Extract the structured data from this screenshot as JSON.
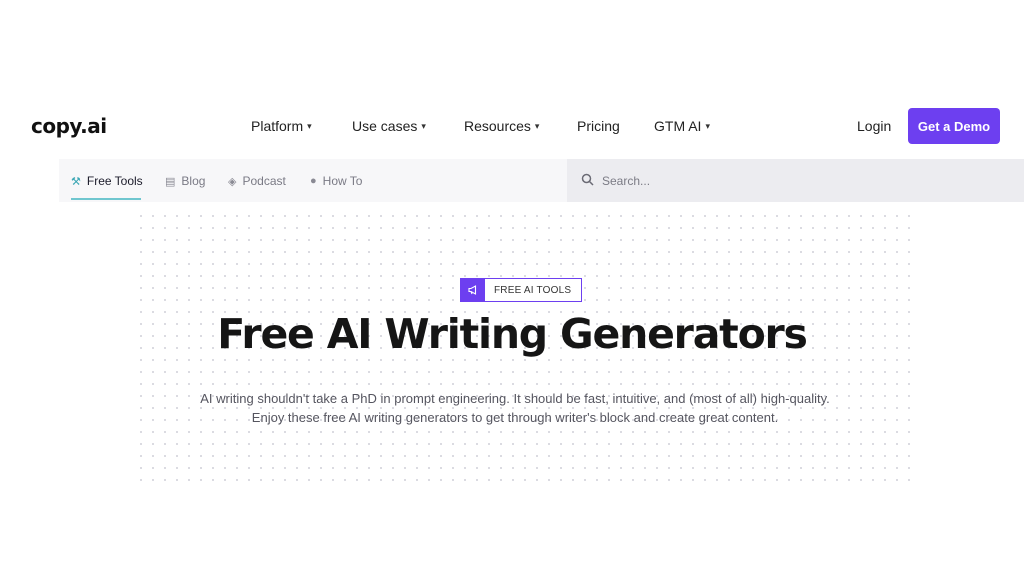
{
  "header": {
    "logo": "copy.ai",
    "nav": [
      {
        "label": "Platform",
        "has_dropdown": true
      },
      {
        "label": "Use cases",
        "has_dropdown": true
      },
      {
        "label": "Resources",
        "has_dropdown": true
      },
      {
        "label": "Pricing",
        "has_dropdown": false
      },
      {
        "label": "GTM AI",
        "has_dropdown": true
      }
    ],
    "login_label": "Login",
    "cta_label": "Get a Demo",
    "chevron": "⌄"
  },
  "subnav": {
    "items": [
      {
        "label": "Free Tools",
        "icon": "tools-icon",
        "active": true
      },
      {
        "label": "Blog",
        "icon": "newspaper-icon",
        "active": false
      },
      {
        "label": "Podcast",
        "icon": "graduation-cap-icon",
        "active": false
      },
      {
        "label": "How To",
        "icon": "info-circle-icon",
        "active": false
      }
    ],
    "search": {
      "placeholder": "Search...",
      "value": ""
    }
  },
  "hero": {
    "badge_icon": "megaphone-icon",
    "badge_text": "FREE AI TOOLS",
    "title": "Free AI Writing Generators",
    "description_line1": "AI writing shouldn't take a PhD in prompt engineering. It should be fast, intuitive, and (most of all) high-quality.",
    "description_line2": "Enjoy these free AI writing generators to get through writer's block and create great content."
  },
  "colors": {
    "accent": "#6d3ff0",
    "subnav_active_underline": "#6fc6cf",
    "subnav_bg": "#f7f7f9",
    "search_bg": "#ececf0"
  }
}
